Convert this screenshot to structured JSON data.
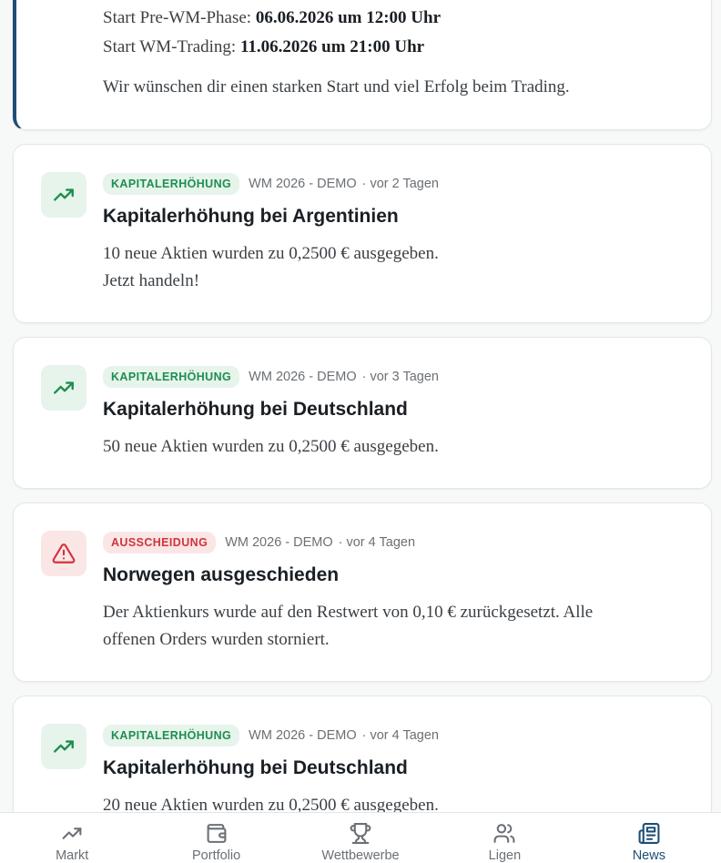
{
  "feed": {
    "first": {
      "start_pre_label": "Start Pre-WM-Phase: ",
      "start_pre_value": "06.06.2026 um 12:00 Uhr",
      "start_wm_label": "Start WM-Trading: ",
      "start_wm_value": "11.06.2026 um 21:00 Uhr",
      "wish": "Wir wünschen dir einen starken Start und viel Erfolg beim Trading."
    },
    "items": [
      {
        "badge": "KAPITALERHÖHUNG",
        "league": "WM 2026 - DEMO",
        "age": "· vor 2 Tagen",
        "title": "Kapitalerhöhung bei Argentinien",
        "text_line1": "10 neue Aktien wurden zu 0,2500 € ausgegeben.",
        "text_line2": "Jetzt handeln!",
        "icon": "trending-up-icon"
      },
      {
        "badge": "KAPITALERHÖHUNG",
        "league": "WM 2026 - DEMO",
        "age": "· vor 3 Tagen",
        "title": "Kapitalerhöhung bei Deutschland",
        "text_line1": "50 neue Aktien wurden zu 0,2500 € ausgegeben.",
        "icon": "trending-up-icon"
      },
      {
        "badge": "AUSSCHEIDUNG",
        "league": "WM 2026 - DEMO",
        "age": "· vor 4 Tagen",
        "title": "Norwegen ausgeschieden",
        "text_line1": "Der Aktienkurs wurde auf den Restwert von 0,10 € zurückgesetzt. Alle",
        "text_line2": "offenen Orders wurden storniert.",
        "icon": "warning-icon"
      },
      {
        "badge": "KAPITALERHÖHUNG",
        "league": "WM 2026 - DEMO",
        "age": "· vor 4 Tagen",
        "title": "Kapitalerhöhung bei Deutschland",
        "text_line1": "20 neue Aktien wurden zu 0,2500 € ausgegeben.",
        "icon": "trending-up-icon"
      }
    ]
  },
  "tabbar": {
    "markt": "Markt",
    "portfolio": "Portfolio",
    "wettbewerbe": "Wettbewerbe",
    "ligen": "Ligen",
    "news": "News",
    "active": "News"
  },
  "colors": {
    "accent": "#1e4e74",
    "green_badge_bg": "#e6f4ec",
    "green_badge_text": "#1e8e4e",
    "red_badge_bg": "#fbe6e6",
    "red_badge_text": "#d0343a"
  }
}
